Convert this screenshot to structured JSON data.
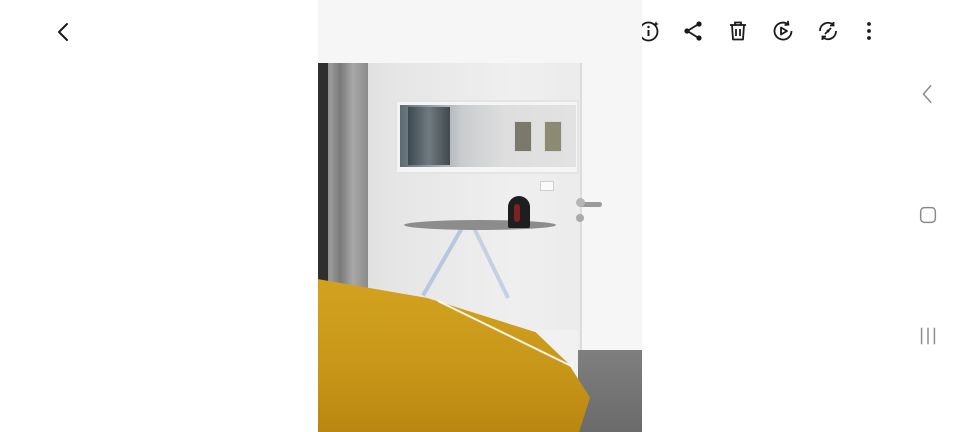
{
  "topbar": {
    "icons": {
      "back": "chevron-left-icon",
      "favorite": "heart-icon",
      "edit": "pencil-icon",
      "info": "info-sparkle-icon",
      "share": "share-icon",
      "delete": "trash-icon",
      "video": "play-circle-icon",
      "remaster": "remaster-icon",
      "more": "more-vertical-icon"
    }
  },
  "photo": {
    "description_visible": ""
  },
  "navbar": {
    "icons": {
      "back": "chevron-left-icon",
      "home": "square-icon",
      "recents": "recents-icon"
    }
  },
  "colors": {
    "icon": "#1a1a1a",
    "navbar_icon": "#8a8a8a",
    "blanket": "#c9981a"
  }
}
